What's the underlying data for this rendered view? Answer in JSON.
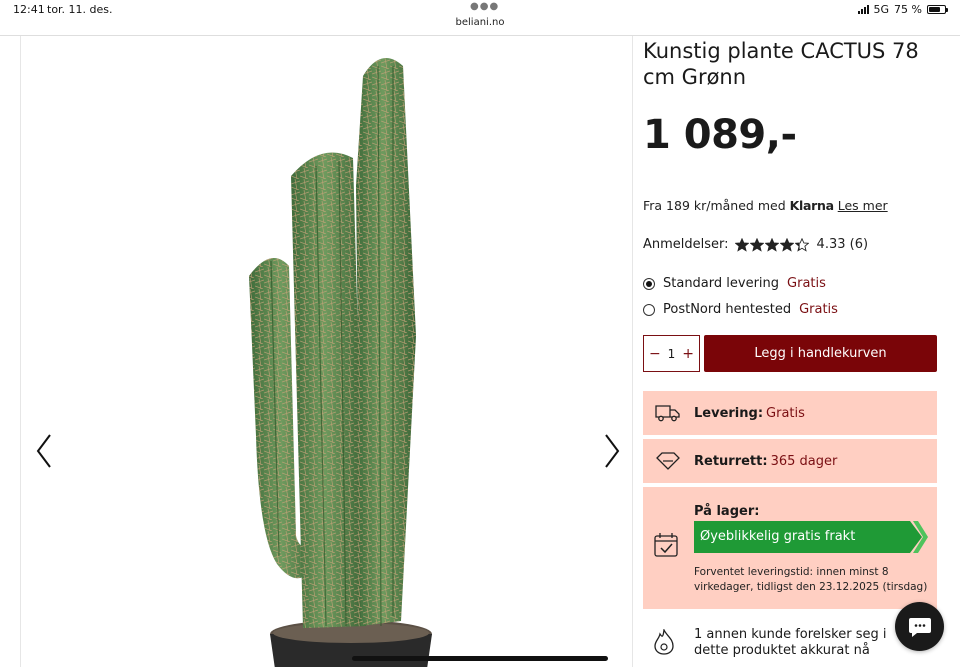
{
  "status_bar": {
    "time": "12:41",
    "date": "tor. 11. des.",
    "network": "5G",
    "battery_percent": "75 %",
    "battery_level": 0.75
  },
  "browser": {
    "url": "beliani.no"
  },
  "product": {
    "title": "Kunstig plante CACTUS 78 cm Grønn",
    "price": "1 089,-",
    "klarna": {
      "prefix": "Fra 189 kr/måned med",
      "brand": "Klarna",
      "link": "Les mer"
    },
    "reviews": {
      "label": "Anmeldelser:",
      "rating": 4.33,
      "stars_max": 5,
      "score_text": "4.33 (6)"
    }
  },
  "shipping_options": [
    {
      "label": "Standard levering",
      "price": "Gratis",
      "selected": true
    },
    {
      "label": "PostNord hentested",
      "price": "Gratis",
      "selected": false
    }
  ],
  "cart": {
    "quantity": "1",
    "minus": "−",
    "plus": "+",
    "add_label": "Legg i handlekurven"
  },
  "info": {
    "delivery": {
      "key": "Levering:",
      "value": "Gratis",
      "icon": "truck-icon"
    },
    "returns": {
      "key": "Returrett:",
      "value": "365 dager",
      "icon": "return-365-icon"
    },
    "stock": {
      "key": "På lager:",
      "badge": "Øyeblikkelig gratis frakt",
      "eta": "Forventet leveringstid: innen minst 8 virkedager, tidligst den 23.12.2025 (tirsdag)",
      "icon": "calendar-check-icon"
    },
    "social": {
      "text": "1 annen kunde forelsker seg i dette produktet akkurat nå",
      "icon": "flame-icon"
    }
  },
  "colors": {
    "brand_red": "#7a0508",
    "accent_red_text": "#7a0f13",
    "info_bg": "#ffcfc2",
    "stock_green": "#1f9a36"
  }
}
